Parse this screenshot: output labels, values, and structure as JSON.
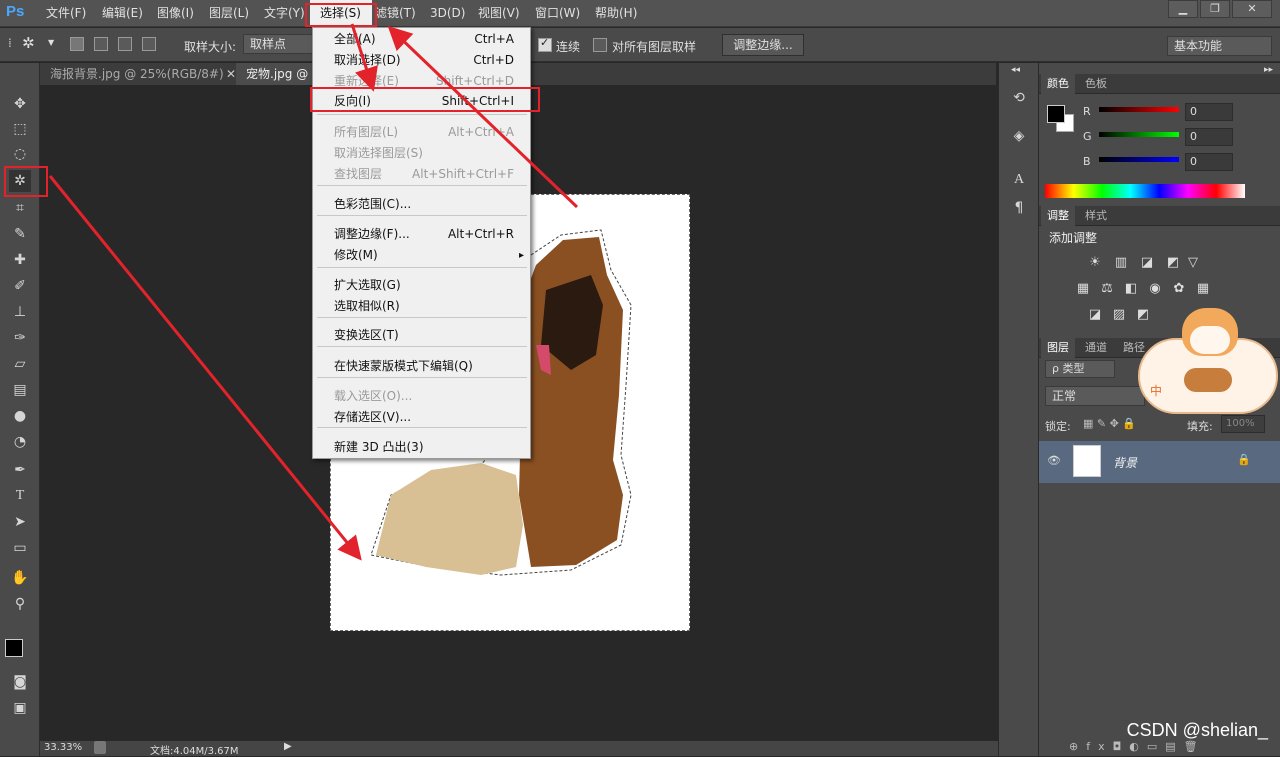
{
  "app": {
    "logo": "Ps"
  },
  "menubar": [
    "文件(F)",
    "编辑(E)",
    "图像(I)",
    "图层(L)",
    "文字(Y)",
    "选择(S)",
    "滤镜(T)",
    "3D(D)",
    "视图(V)",
    "窗口(W)",
    "帮助(H)"
  ],
  "options": {
    "sample_size_label": "取样大小:",
    "sample_size_value": "取样点",
    "contiguous": "连续",
    "all_layers": "对所有图层取样",
    "refine_edge": "调整边缘...",
    "workspace": "基本功能"
  },
  "tabs": [
    "海报背景.jpg @ 25%(RGB/8#)",
    "宠物.jpg @ 3"
  ],
  "select_menu": {
    "items": [
      {
        "label": "全部(A)",
        "shortcut": "Ctrl+A",
        "disabled": false
      },
      {
        "label": "取消选择(D)",
        "shortcut": "Ctrl+D",
        "disabled": false
      },
      {
        "label": "重新选择(E)",
        "shortcut": "Shift+Ctrl+D",
        "disabled": true
      },
      {
        "label": "反向(I)",
        "shortcut": "Shift+Ctrl+I",
        "disabled": false
      },
      {
        "label": "所有图层(L)",
        "shortcut": "Alt+Ctrl+A",
        "disabled": true
      },
      {
        "label": "取消选择图层(S)",
        "shortcut": "",
        "disabled": true
      },
      {
        "label": "查找图层",
        "shortcut": "Alt+Shift+Ctrl+F",
        "disabled": true
      },
      {
        "label": "色彩范围(C)...",
        "shortcut": "",
        "disabled": false
      },
      {
        "label": "调整边缘(F)...",
        "shortcut": "Alt+Ctrl+R",
        "disabled": false
      },
      {
        "label": "修改(M)",
        "shortcut": "",
        "disabled": false
      },
      {
        "label": "扩大选取(G)",
        "shortcut": "",
        "disabled": false
      },
      {
        "label": "选取相似(R)",
        "shortcut": "",
        "disabled": false
      },
      {
        "label": "变换选区(T)",
        "shortcut": "",
        "disabled": false
      },
      {
        "label": "在快速蒙版模式下编辑(Q)",
        "shortcut": "",
        "disabled": false
      },
      {
        "label": "载入选区(O)...",
        "shortcut": "",
        "disabled": true
      },
      {
        "label": "存储选区(V)...",
        "shortcut": "",
        "disabled": false
      },
      {
        "label": "新建 3D 凸出(3)",
        "shortcut": "",
        "disabled": false
      }
    ]
  },
  "color_panel": {
    "tabs": [
      "颜色",
      "色板"
    ],
    "channels": [
      {
        "name": "R",
        "value": "0"
      },
      {
        "name": "G",
        "value": "0"
      },
      {
        "name": "B",
        "value": "0"
      }
    ]
  },
  "adjust_panel": {
    "tabs": [
      "调整",
      "样式"
    ],
    "title": "添加调整"
  },
  "layers_panel": {
    "tabs": [
      "图层",
      "通道",
      "路径"
    ],
    "filter": "ρ 类型",
    "blend": "正常",
    "lock_label": "锁定:",
    "fill_label": "填充:",
    "fill_value": "100%",
    "layer_name": "背景"
  },
  "status": {
    "zoom": "33.33%",
    "doc": "文档:4.04M/3.67M"
  },
  "watermark": "CSDN @shelian_",
  "colors": {
    "accent_red": "#e3232b",
    "ps_blue": "#4aa7ff"
  }
}
